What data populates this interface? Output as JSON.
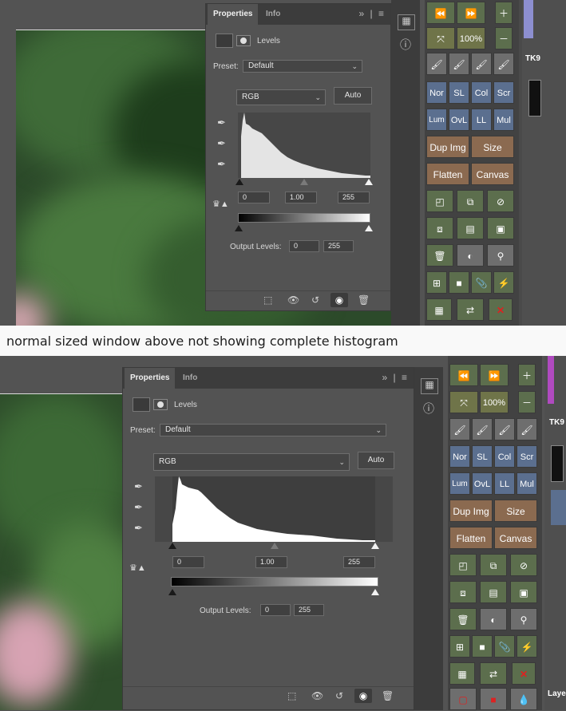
{
  "caption": "normal sized window above not showing complete histogram",
  "panel_top": {
    "tabs": [
      "Properties",
      "Info"
    ],
    "title": "Levels",
    "preset_label": "Preset:",
    "preset_value": "Default",
    "channel": "RGB",
    "auto_label": "Auto",
    "input_black": "0",
    "input_gamma": "1.00",
    "input_white": "255",
    "output_label": "Output Levels:",
    "output_black": "0",
    "output_white": "255"
  },
  "panel_bottom": {
    "tabs": [
      "Properties",
      "Info"
    ],
    "title": "Levels",
    "preset_label": "Preset:",
    "preset_value": "Default",
    "channel": "RGB",
    "auto_label": "Auto",
    "input_black": "0",
    "input_gamma": "1.00",
    "input_white": "255",
    "output_label": "Output Levels:",
    "output_black": "0",
    "output_white": "255"
  },
  "toolbar_top": {
    "zoom": "100%",
    "blend_modes": [
      "Nor",
      "SL",
      "Col",
      "Scr"
    ],
    "blend_modes2": [
      "Lum",
      "OvL",
      "LL",
      "Mul"
    ],
    "dup_img": "Dup Img",
    "size": "Size",
    "flatten": "Flatten",
    "canvas": "Canvas",
    "panel_label": "TK9"
  },
  "toolbar_bottom": {
    "zoom": "100%",
    "blend_modes": [
      "Nor",
      "SL",
      "Col",
      "Scr"
    ],
    "blend_modes2": [
      "Lum",
      "OvL",
      "LL",
      "Mul"
    ],
    "dup_img": "Dup Img",
    "size": "Size",
    "flatten": "Flatten",
    "canvas": "Canvas",
    "panel_label": "TK9",
    "layers_label": "Laye"
  },
  "colors": {
    "accent_green": "#5c6e4d",
    "blue_btn": "#5b6f8f",
    "brown_btn": "#8b6a50",
    "red_x": "#e02020"
  }
}
